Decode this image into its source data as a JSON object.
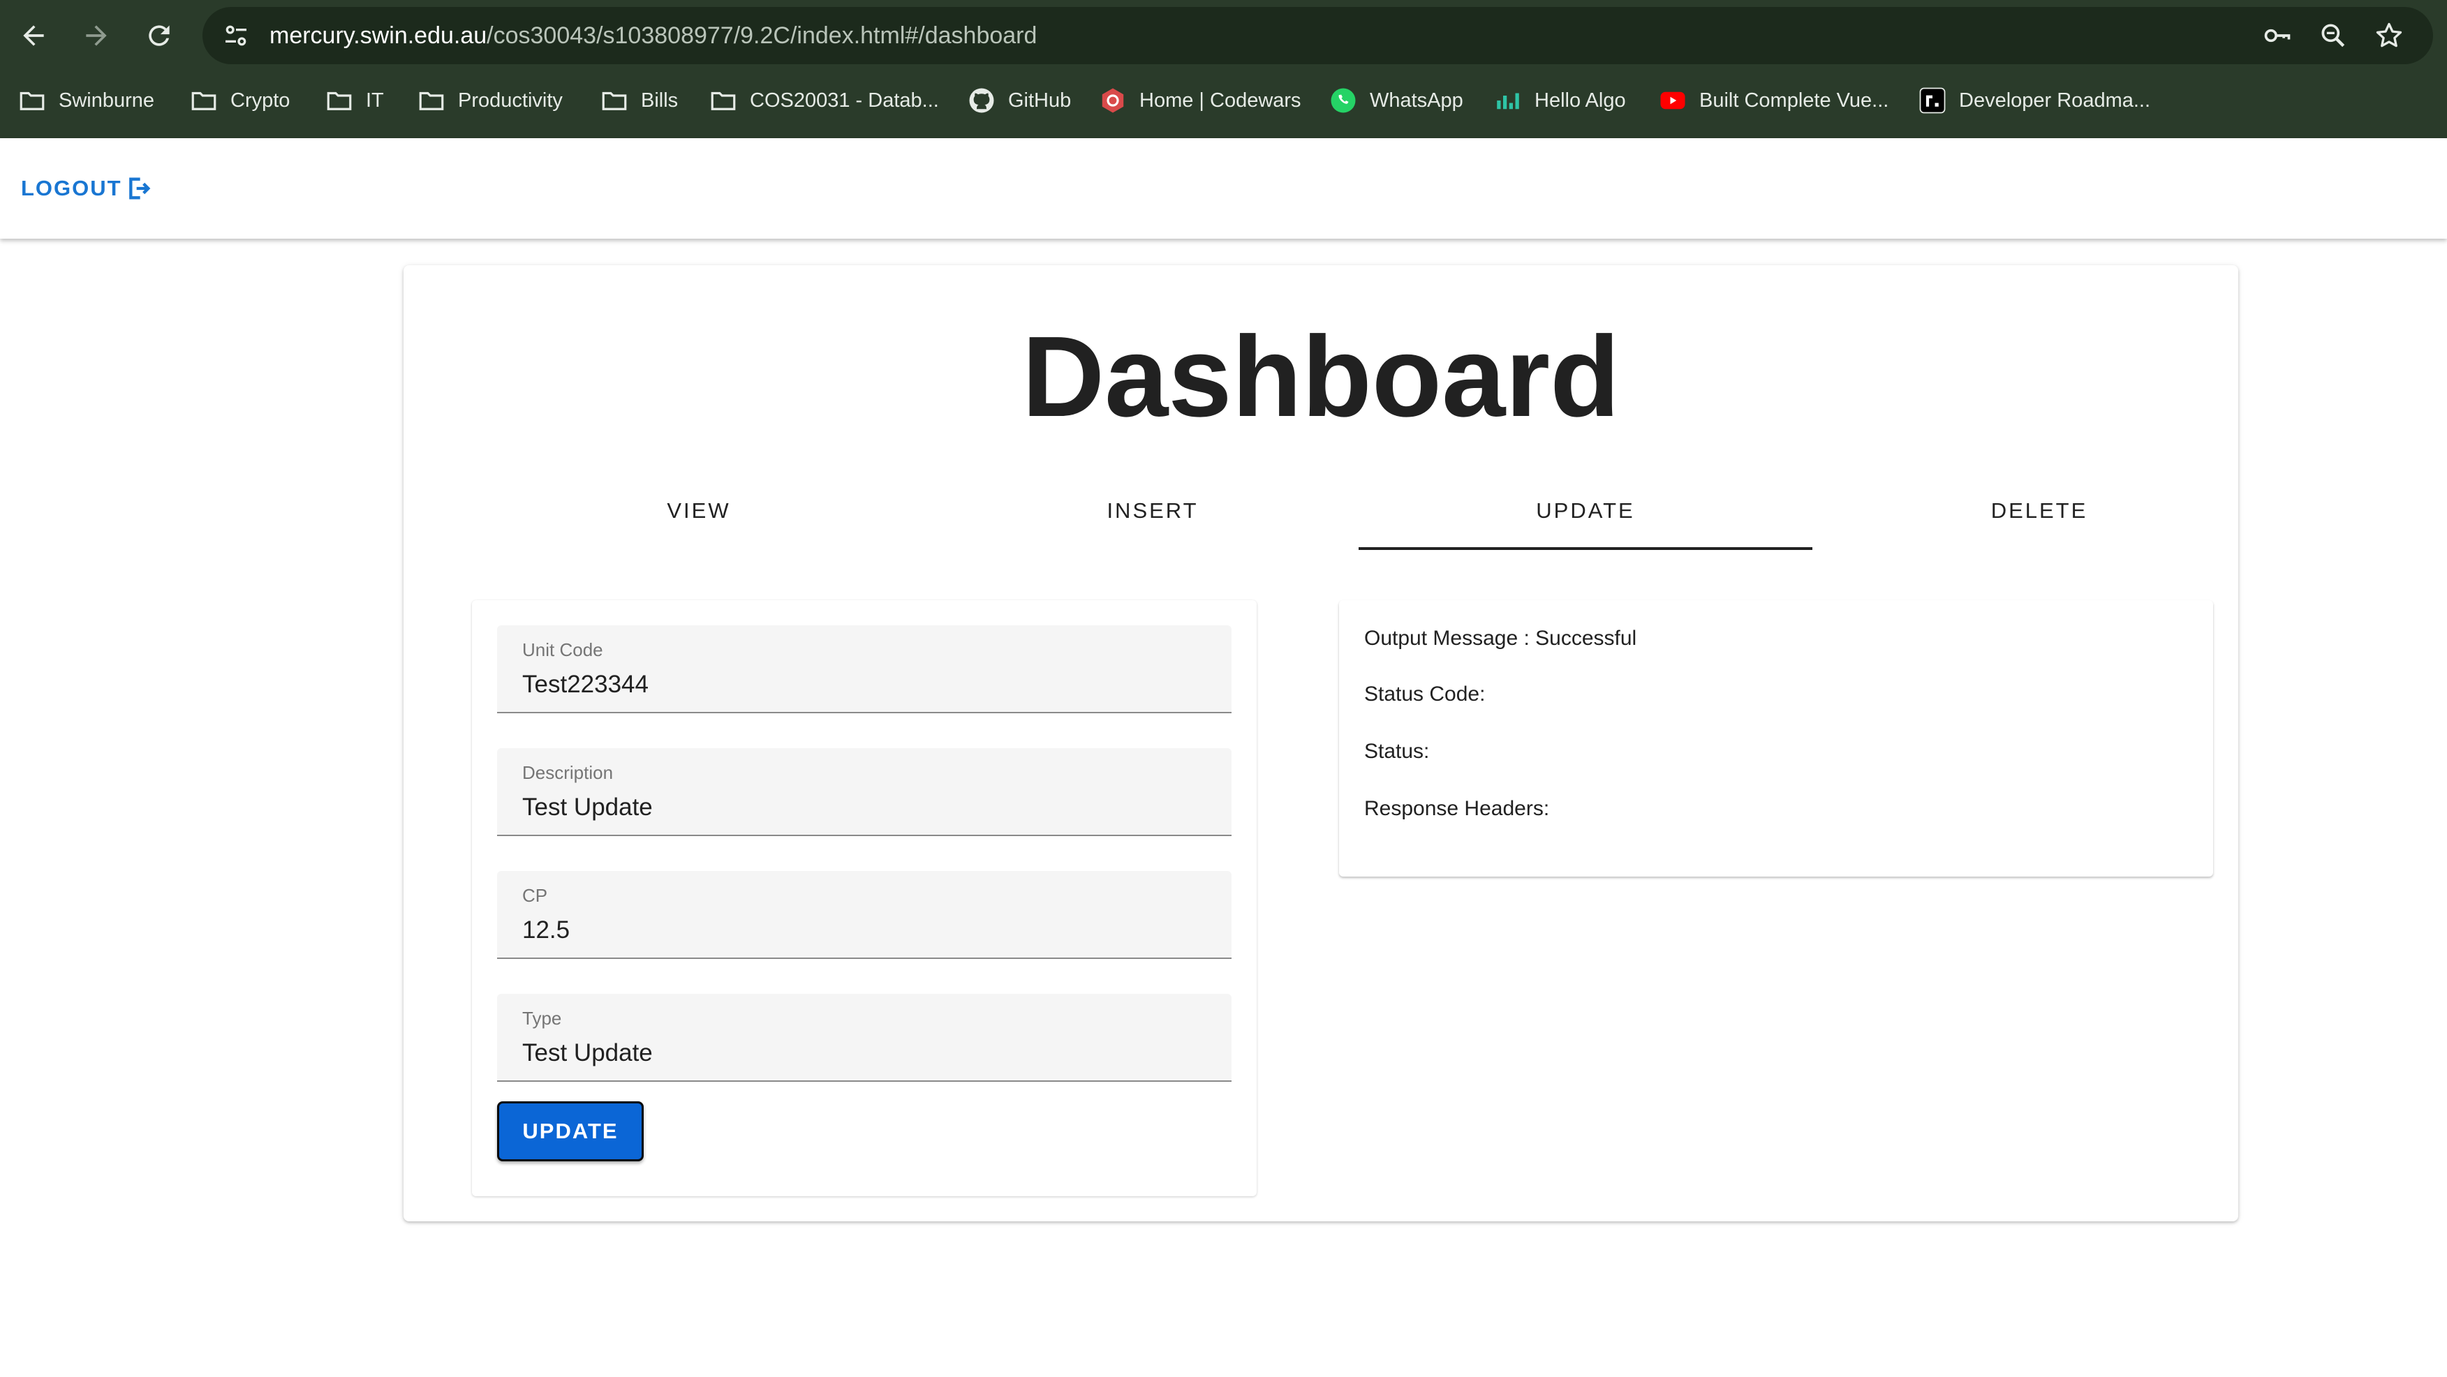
{
  "browser": {
    "url_host": "mercury.swin.edu.au",
    "url_path": "/cos30043/s103808977/9.2C/index.html#/dashboard",
    "bookmarks": [
      {
        "label": "Swinburne",
        "icon": "folder-icon"
      },
      {
        "label": "Crypto",
        "icon": "folder-icon"
      },
      {
        "label": "IT",
        "icon": "folder-icon"
      },
      {
        "label": "Productivity",
        "icon": "folder-icon"
      },
      {
        "label": "Bills",
        "icon": "folder-icon"
      },
      {
        "label": "COS20031 - Datab...",
        "icon": "folder-icon"
      },
      {
        "label": "GitHub",
        "icon": "github-icon"
      },
      {
        "label": "Home | Codewars",
        "icon": "codewars-icon"
      },
      {
        "label": "WhatsApp",
        "icon": "whatsapp-icon"
      },
      {
        "label": "Hello Algo",
        "icon": "hello-algo-icon"
      },
      {
        "label": "Built Complete Vue...",
        "icon": "youtube-icon"
      },
      {
        "label": "Developer Roadma...",
        "icon": "roadmap-icon"
      }
    ]
  },
  "app_bar": {
    "logout_label": "LOGOUT"
  },
  "dashboard": {
    "title": "Dashboard",
    "tabs": [
      {
        "label": "VIEW",
        "active": false
      },
      {
        "label": "INSERT",
        "active": false
      },
      {
        "label": "UPDATE",
        "active": true
      },
      {
        "label": "DELETE",
        "active": false
      }
    ]
  },
  "form": {
    "fields": [
      {
        "label": "Unit Code",
        "value": "Test223344"
      },
      {
        "label": "Description",
        "value": "Test Update"
      },
      {
        "label": "CP",
        "value": "12.5"
      },
      {
        "label": "Type",
        "value": "Test Update"
      }
    ],
    "submit_label": "UPDATE"
  },
  "output": {
    "message": "Output Message : Successful",
    "status_code": "Status Code:",
    "status": "Status:",
    "response_headers": "Response Headers:"
  },
  "colors": {
    "chrome_bg": "#2a3b2a",
    "accent": "#1976d2",
    "button_bg": "#0b66d6"
  }
}
